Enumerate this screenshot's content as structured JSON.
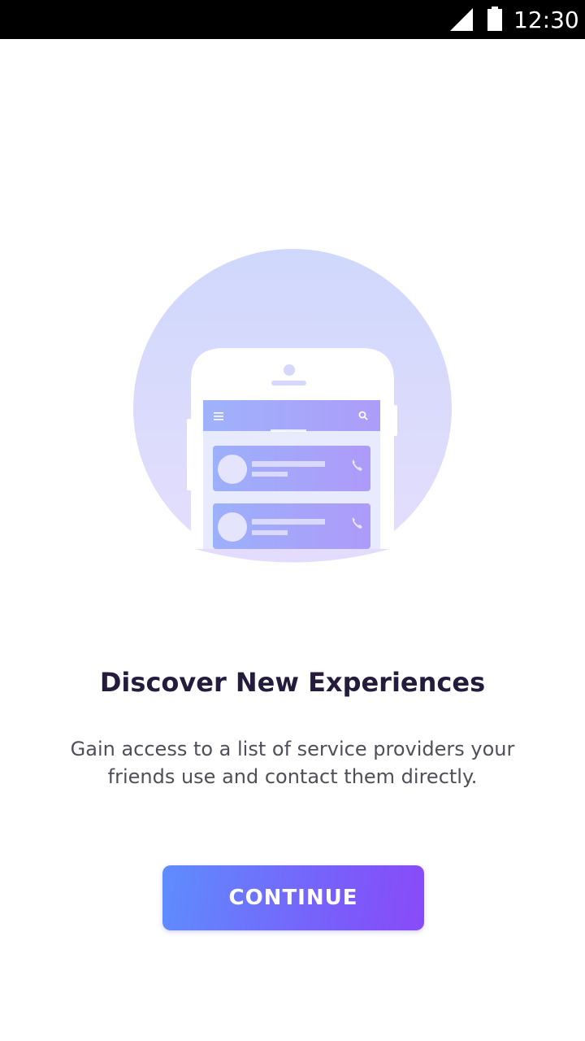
{
  "status_bar": {
    "time": "12:30",
    "icons": [
      "signal-icon",
      "battery-icon"
    ]
  },
  "illustration": {
    "icons": [
      "phone-illustration",
      "menu-icon",
      "search-icon",
      "phone-call-icon"
    ]
  },
  "onboarding": {
    "title": "Discover New Experiences",
    "description": "Gain access to a list of service providers your friends use and contact them directly.",
    "continue_label": "CONTINUE"
  },
  "colors": {
    "title": "#241b3d",
    "body_text": "#4f4f5a",
    "button_start": "#5e8dfd",
    "button_end": "#8a4af8",
    "circle_top": "#cfd8fc",
    "circle_bottom": "#e4dcfd"
  }
}
